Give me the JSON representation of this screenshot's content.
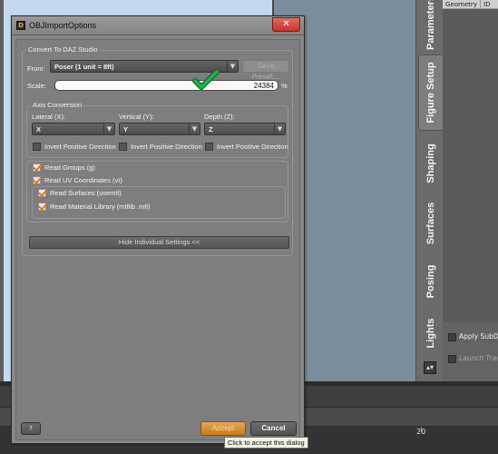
{
  "window": {
    "title": "OBJImportOptions",
    "close_glyph": "✕",
    "app_icon_glyph": "D"
  },
  "convert": {
    "group_title": "Convert To DAZ Studio",
    "from_label": "From:",
    "from_value": "Poser (1 unit = 8ft)",
    "save_preset_label": "Save Preset...",
    "scale_label": "Scale:",
    "scale_value": "24384",
    "scale_unit": "%"
  },
  "axis": {
    "group_title": "Axis Conversion",
    "lateral_label": "Lateral (X):",
    "lateral_value": "X",
    "vertical_label": "Vertical (Y):",
    "vertical_value": "Y",
    "depth_label": "Depth (Z):",
    "depth_value": "Z",
    "invert_label": "Invert Positive Direction"
  },
  "options": {
    "read_groups": "Read Groups (g)",
    "read_uv": "Read UV Coordinates (vt)",
    "read_surfaces": "Read Surfaces (usemtl)",
    "read_material_library": "Read Material Library (mtllib .mtl)"
  },
  "hide_settings_label": "Hide Individual Settings <<",
  "footer": {
    "help_label": "?",
    "accept_label": "Accept",
    "cancel_label": "Cancel"
  },
  "tooltip": "Click to accept this dialog",
  "side_tabs": [
    "Parameters",
    "Figure Setup",
    "Shaping",
    "Surfaces",
    "Posing",
    "Lights"
  ],
  "right_panel": {
    "col_geometry": "Geometry",
    "col_id": "ID",
    "apply_subd": "Apply SubD",
    "launch_transfer": "Launch Transfer"
  },
  "timeline": {
    "tick_20": "20"
  },
  "colors": {
    "accept_orange": "#e9a650",
    "check_green": "#1fb34a",
    "close_red": "#c2362a"
  }
}
